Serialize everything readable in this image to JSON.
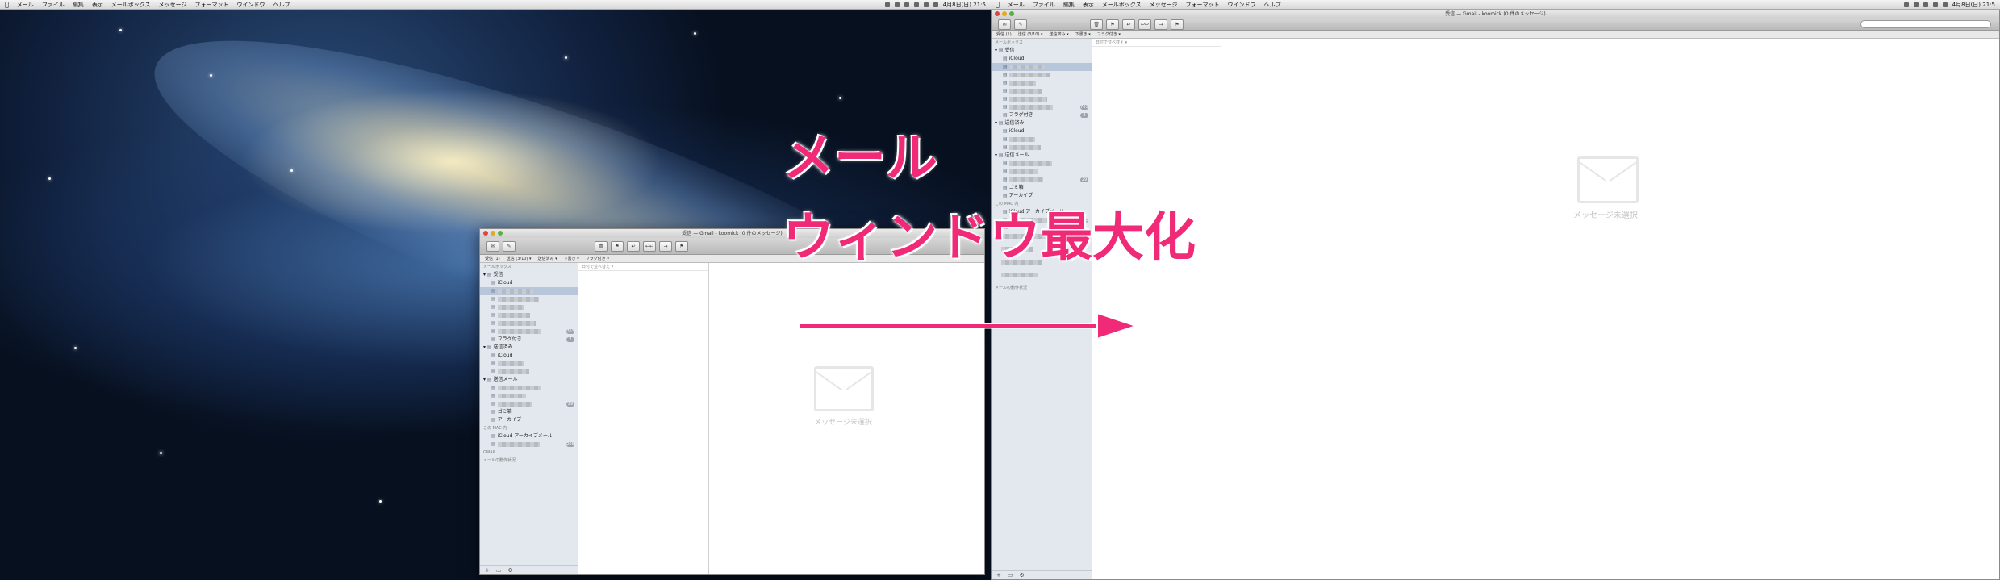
{
  "menubar": {
    "items": [
      "メール",
      "ファイル",
      "編集",
      "表示",
      "メールボックス",
      "メッセージ",
      "フォーマット",
      "ウインドウ",
      "ヘルプ"
    ],
    "clock": "4月8日(日) 21:5"
  },
  "mail_window": {
    "title": "受信 — Gmail - koomick (0 件のメッセージ)",
    "favorites": [
      "受信 (1)",
      "送信 (3/10) ▾",
      "送信済み ▾",
      "下書き ▾",
      "フラグ付き ▾"
    ],
    "sidebar_header": "メールボックス",
    "mailboxes": [
      {
        "label": "受信",
        "expanded": true
      },
      {
        "label": "iCloud"
      },
      {
        "label": ""
      },
      {
        "label": ""
      },
      {
        "label": ""
      },
      {
        "label": ""
      },
      {
        "label": ""
      },
      {
        "label": "",
        "badge": "703"
      },
      {
        "label": "フラグ付き",
        "badge": "2"
      },
      {
        "label": "送信済み",
        "expanded": true
      },
      {
        "label": "iCloud"
      },
      {
        "label": ""
      },
      {
        "label": ""
      },
      {
        "label": "送信メール",
        "expanded": true
      },
      {
        "label": ""
      },
      {
        "label": ""
      },
      {
        "label": "",
        "badge": "29"
      },
      {
        "label": "ゴミ箱"
      },
      {
        "label": "アーカイブ"
      },
      {
        "label": "この MAC 内",
        "header": true
      },
      {
        "label": "iCloud アーカイブメール"
      },
      {
        "label": "",
        "badge": "205"
      },
      {
        "label": "GMAIL",
        "header": true
      }
    ],
    "activity_label": "メールの動作状況",
    "sort_label": "日付で並べ替え ▾",
    "no_message": "メッセージ未選択"
  },
  "annotation": {
    "line1": "メール",
    "line2": "ウィンドウ最大化",
    "color": "#f02a76"
  },
  "right_search_placeholder": ""
}
